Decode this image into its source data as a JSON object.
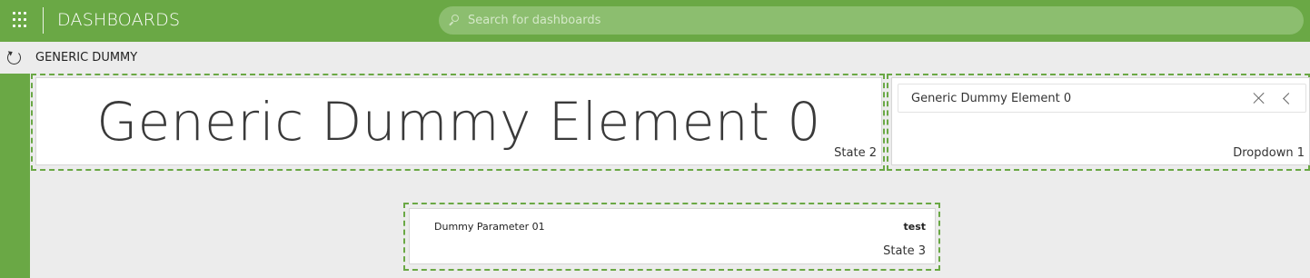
{
  "topbar": {
    "apps_icon": "apps-grid-icon",
    "title": "DASHBOARDS",
    "search_placeholder": "Search for dashboards",
    "search_value": "",
    "search_icon": "search-icon",
    "accent_color": "#6aa845"
  },
  "subheader": {
    "refresh_icon": "refresh-icon",
    "title": "GENERIC DUMMY"
  },
  "components": {
    "state2": {
      "text": "Generic Dummy Element 0",
      "label": "State 2"
    },
    "dropdown1": {
      "selected": "Generic Dummy Element 0",
      "clear_icon": "close-icon",
      "expand_icon": "chevron-left-icon",
      "label": "Dropdown 1"
    },
    "state3": {
      "parameter_name": "Dummy Parameter 01",
      "parameter_value": "test",
      "label": "State 3"
    }
  }
}
